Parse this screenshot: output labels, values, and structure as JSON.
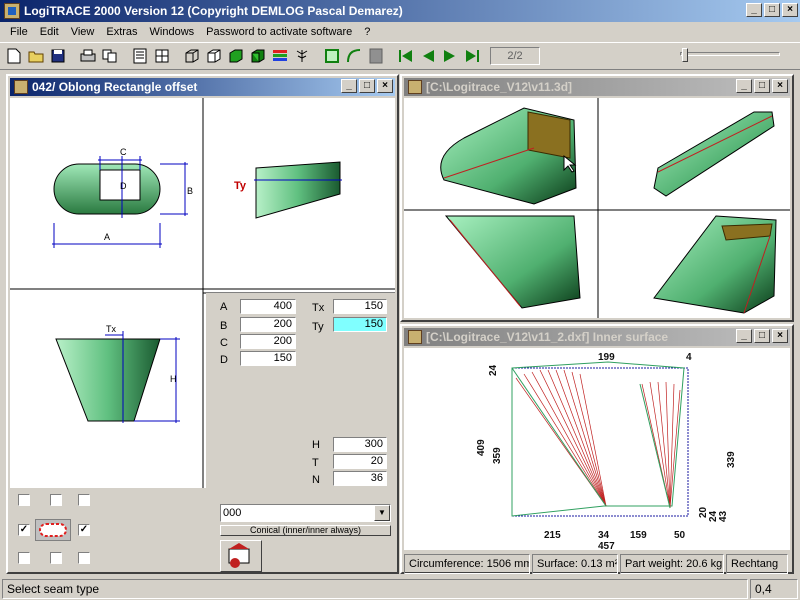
{
  "app": {
    "title": "LogiTRACE 2000  Version 12  (Copyright DEMLOG Pascal Demarez)"
  },
  "window_buttons": {
    "minimize": "_",
    "maximize": "□",
    "close": "×"
  },
  "menu": [
    "File",
    "Edit",
    "View",
    "Extras",
    "Windows",
    "Password to activate software",
    "?"
  ],
  "toolbar": {
    "page": "2/2"
  },
  "left_window": {
    "title": "042/ Oblong Rectangle offset",
    "params": [
      {
        "label": "A",
        "value": "400"
      },
      {
        "label": "B",
        "value": "200"
      },
      {
        "label": "C",
        "value": "200"
      },
      {
        "label": "D",
        "value": "150"
      }
    ],
    "offsets": [
      {
        "label": "Tx",
        "value": "150"
      },
      {
        "label": "Ty",
        "value": "150"
      }
    ],
    "dims": [
      {
        "label": "H",
        "value": "300"
      },
      {
        "label": "T",
        "value": "20"
      },
      {
        "label": "N",
        "value": "36"
      }
    ],
    "combo_value": "000",
    "combo_button": "Conical (inner/inner always)",
    "drawing_labels": {
      "a": "A",
      "b": "B",
      "c": "C",
      "d": "D",
      "h": "H",
      "tx": "Tx",
      "ty": "Ty"
    }
  },
  "view3d_window": {
    "title": "[C:\\Logitrace_V12\\v11.3d]"
  },
  "dxf_window": {
    "title": "[C:\\Logitrace_V12\\v11_2.dxf]  Inner surface",
    "status": [
      "Circumference: 1506 mm",
      "Surface: 0.13 m²",
      "Part weight: 20.6 kg",
      "Rechtang"
    ],
    "dims": {
      "top": "199",
      "top_right": "4",
      "left_small": "24",
      "left_outer": "409",
      "left_inner": "359",
      "right": "339",
      "bottom1": "215",
      "bottom2": "34",
      "bottom3": "159",
      "bottom4": "50",
      "bottom_total": "457",
      "right_small1": "20",
      "right_small2": "24",
      "right_small3": "43"
    }
  },
  "statusbar": {
    "message": "Select seam type",
    "coord": "0,4"
  }
}
